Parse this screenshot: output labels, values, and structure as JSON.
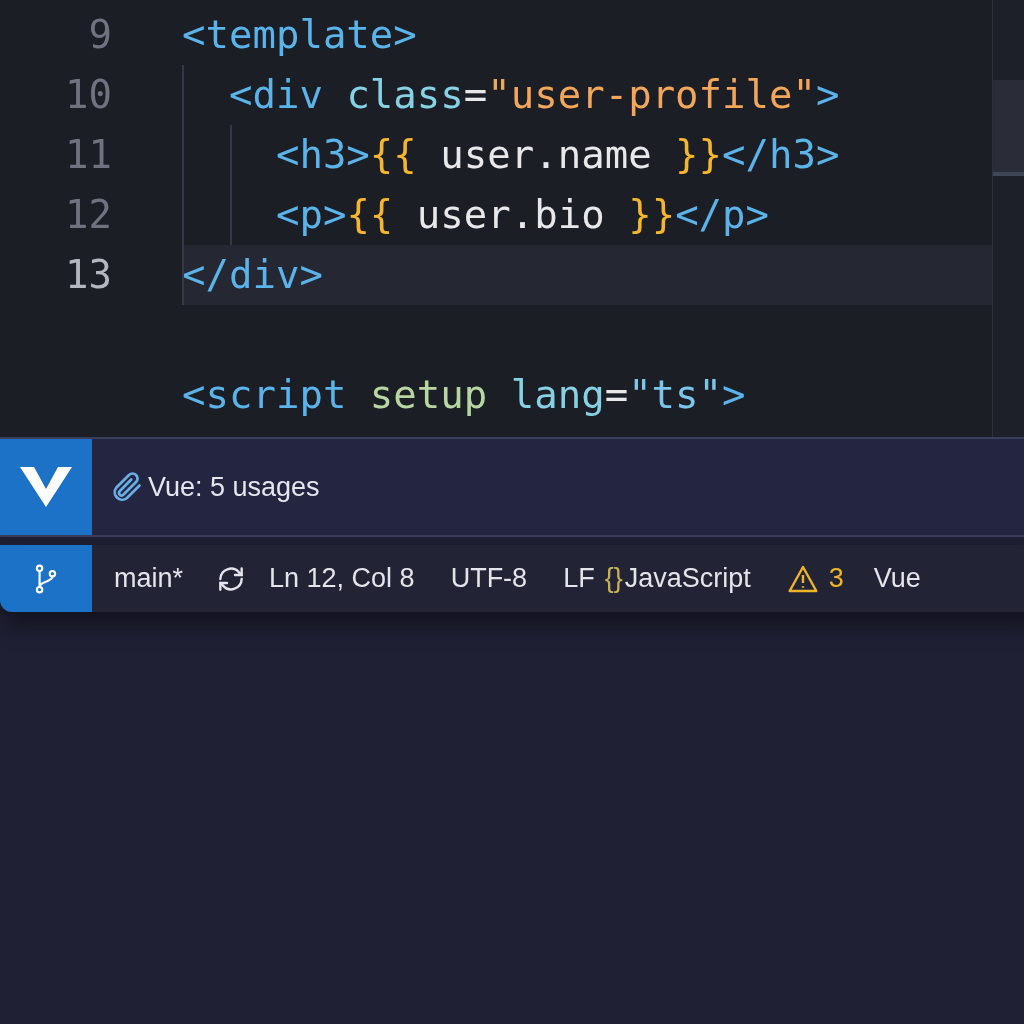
{
  "editor": {
    "lines": [
      {
        "number": "9",
        "current": false,
        "tokens": [
          {
            "text": "<template>",
            "kind": "tag"
          }
        ]
      },
      {
        "number": "10",
        "current": false,
        "tokens": [
          {
            "text": "  <div ",
            "kind": "tag"
          },
          {
            "text": "class",
            "kind": "attr"
          },
          {
            "text": "=",
            "kind": "plain"
          },
          {
            "text": "\"user-profile\"",
            "kind": "string"
          },
          {
            "text": ">",
            "kind": "tag"
          }
        ]
      },
      {
        "number": "11",
        "current": false,
        "tokens": [
          {
            "text": "    <h3>",
            "kind": "tag"
          },
          {
            "text": "{{",
            "kind": "brace"
          },
          {
            "text": " user.name ",
            "kind": "plain"
          },
          {
            "text": "}}",
            "kind": "brace"
          },
          {
            "text": "</h3>",
            "kind": "tag"
          }
        ]
      },
      {
        "number": "12",
        "current": false,
        "tokens": [
          {
            "text": "    <p>",
            "kind": "tag"
          },
          {
            "text": "{{",
            "kind": "brace"
          },
          {
            "text": " user.bio ",
            "kind": "plain"
          },
          {
            "text": "}}",
            "kind": "brace"
          },
          {
            "text": "</p>",
            "kind": "tag"
          }
        ]
      },
      {
        "number": "13",
        "current": true,
        "tokens": [
          {
            "text": "</div>",
            "kind": "tag"
          }
        ]
      },
      {
        "current": false
      },
      {
        "current": false,
        "tokens": [
          {
            "text": "<script ",
            "kind": "tag"
          },
          {
            "text": "setup ",
            "kind": "keyword"
          },
          {
            "text": "lang",
            "kind": "attr"
          },
          {
            "text": "=",
            "kind": "plain"
          },
          {
            "text": "\"ts\"",
            "kind": "value"
          },
          {
            "text": ">",
            "kind": "tag"
          }
        ]
      }
    ]
  },
  "hint": {
    "text": "Vue: 5 usages"
  },
  "status_bar": {
    "branch": "main*",
    "position": "Ln 12, Col 8",
    "encoding": "UTF-8",
    "line_ending": "LF",
    "language_icon": "{}",
    "language": "JavaScript",
    "warnings": "3",
    "framework": "Vue"
  }
}
